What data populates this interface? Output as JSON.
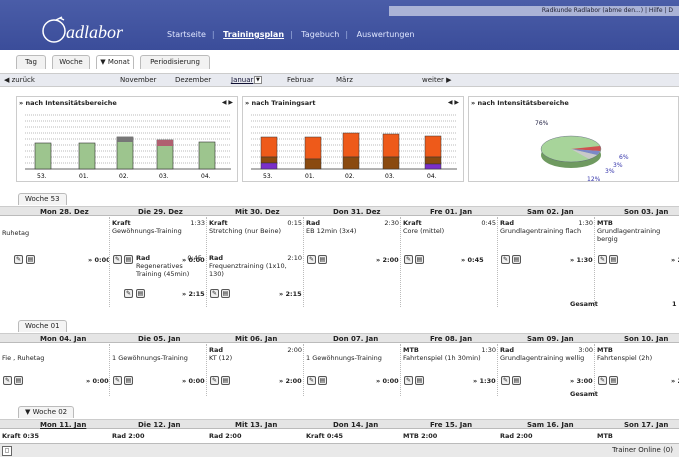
{
  "header": {
    "top_right": "Radkunde Radlabor (abme den...) | Hilfe | D",
    "logo_text": "adlabor",
    "nav": [
      "Startseite",
      "Trainingsplan",
      "Tagebuch",
      "Auswertungen"
    ]
  },
  "view_tabs": [
    "Tag",
    "Woche",
    "▼ Monat",
    "Periodisierung"
  ],
  "month_nav": {
    "back": "◀ zurück",
    "months": [
      "November",
      "Dezember",
      "Januar",
      "Februar",
      "März"
    ],
    "current": "Januar",
    "forward": "weiter ▶"
  },
  "panels": {
    "p1": {
      "title": "» nach Intensitätsbereiche",
      "arrows": "◀ ▶",
      "labels": [
        "53.",
        "01.",
        "02.",
        "03.",
        "04."
      ]
    },
    "p2": {
      "title": "» nach Trainingsart",
      "arrows": "◀ ▶",
      "labels": [
        "53.",
        "01.",
        "02.",
        "03.",
        "04."
      ]
    },
    "p3": {
      "title": "» nach Intensitätsbereiche",
      "arrows": "◀ ▶",
      "pie_labels": [
        "76%",
        "6%",
        "3%",
        "3%",
        "12%"
      ]
    }
  },
  "colors": {
    "header": "#3b4d9a",
    "green": "#9dc58e",
    "orange": "#ee5a1a",
    "brown": "#8a4a10",
    "purple": "#7a2fc9"
  },
  "weeks": [
    {
      "tab": "Woche 53",
      "days": [
        "Mon 28. Dez",
        "Die 29. Dez",
        "Mit 30. Dez",
        "Don 31. Dez",
        "Fre 01. Jan",
        "Sam 02. Jan",
        "Son 03. Jan"
      ],
      "rows": [
        [
          "Ruhetag",
          "Kraft  1:33\nGewöhnungs-Training",
          "Kraft  0:15\nStretching (nur Beine)",
          "Rad  2:30\nEB 12min (3x4)",
          "Kraft  0:45\nCore (mittel)",
          "Rad  1:30\nGrundlagentraining flach",
          "MTB\nGrundlagentraining bergig"
        ],
        [
          "",
          "Rad  0:45\nRegeneratives Training (45min)",
          "Rad  2:10\nFrequenztraining (1x10, 130)",
          "",
          "",
          "",
          ""
        ]
      ],
      "sums": [
        "» 0:00",
        "» 2:15",
        "» 2:15",
        "» 2:00",
        "» 0:45",
        "» 1:30",
        "» 2"
      ],
      "sums2": [
        "",
        "» 2:15",
        "» 2:15"
      ],
      "total": "Gesamt",
      "total_val": "1"
    },
    {
      "tab": "Woche 01",
      "days": [
        "Mon 04. Jan",
        "Die 05. Jan",
        "Mit 06. Jan",
        "Don 07. Jan",
        "Fre 08. Jan",
        "Sam 09. Jan",
        "Son 10. Jan"
      ],
      "rows": [
        [
          "Fie , Ruhetag",
          "1 Gewöhnungs-Training",
          "Rad  2:00\nKT (12)",
          "1 Gewöhnungs-Training",
          "MTB  1:30\nFahrtenspiel (1h 30min)",
          "Rad  3:00\nGrundlagentraining wellig",
          "MTB\nFahrtenspiel (2h)"
        ]
      ],
      "sums": [
        "» 0:00",
        "» 0:00",
        "» 2:00",
        "» 0:00",
        "» 1:30",
        "» 3:00",
        "» 2"
      ],
      "total": "Gesamt"
    },
    {
      "tab": "▼ Woche 02",
      "days": [
        "Mon 11. Jan",
        "Die 12. Jan",
        "Mit 13. Jan",
        "Don 14. Jan",
        "Fre 15. Jan",
        "Sam 16. Jan",
        "Son 17. Jan"
      ],
      "rows": [
        [
          "Kraft  0:35",
          "Rad  2:00",
          "Rad  2:00",
          "Kraft  0:45",
          "MTB  2:00",
          "Rad  2:00",
          "MTB"
        ]
      ]
    }
  ],
  "footer": {
    "status": "Trainer Online (0)"
  }
}
